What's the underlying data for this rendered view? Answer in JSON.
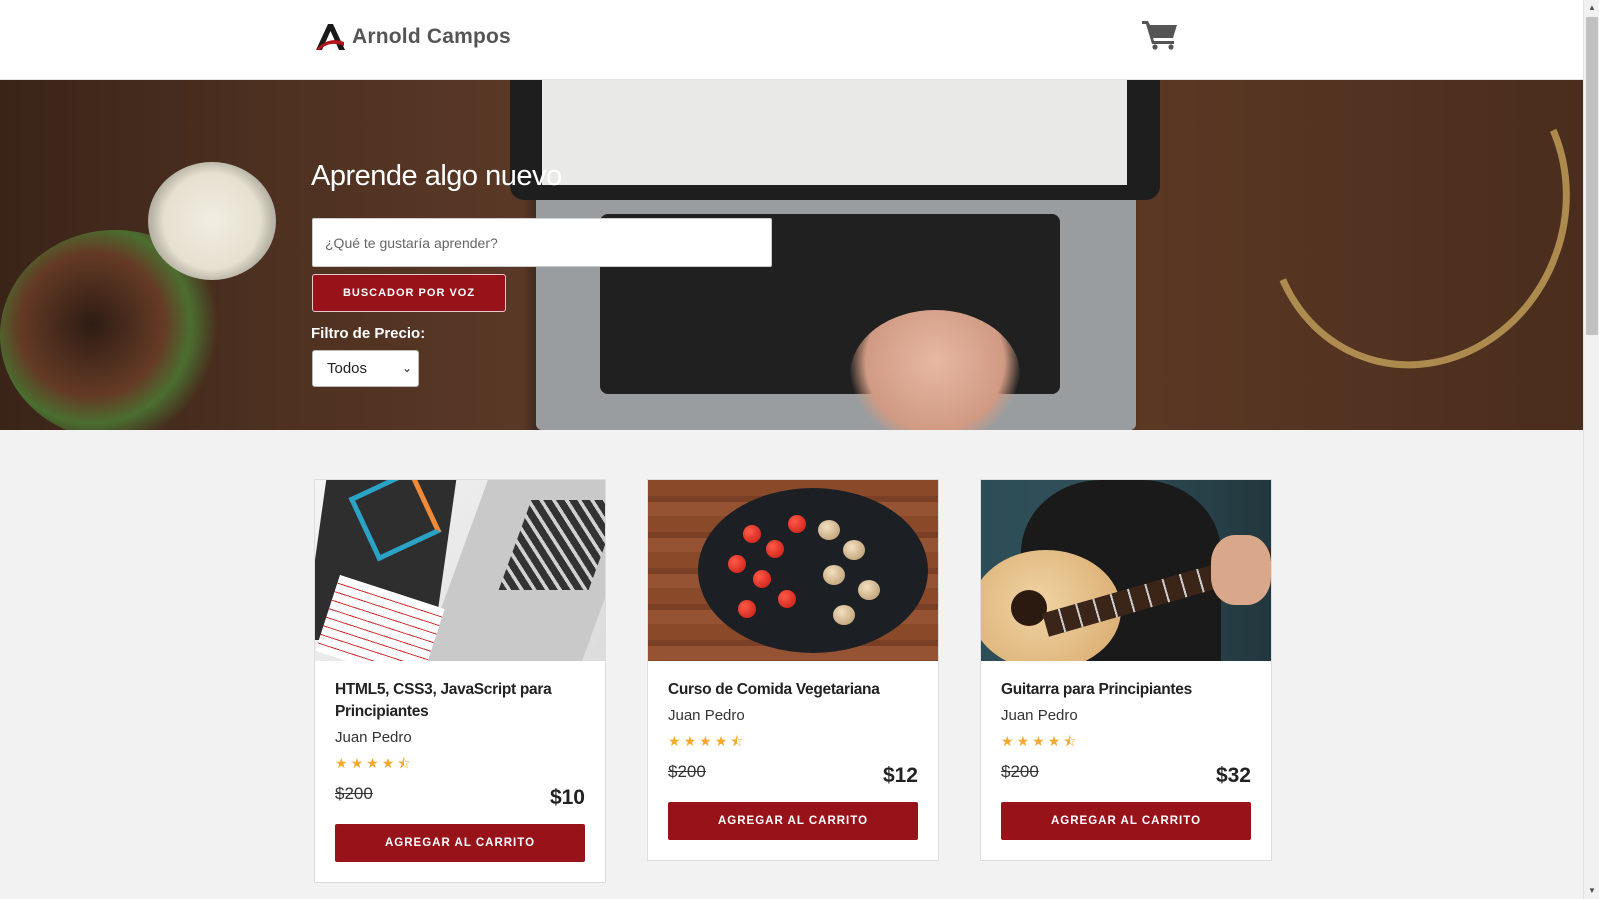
{
  "header": {
    "brand": "Arnold Campos",
    "cart_icon": "shopping-cart-icon"
  },
  "hero": {
    "title": "Aprende algo nuevo",
    "search_placeholder": "¿Qué te gustaría aprender?",
    "voice_button": "BUSCADOR POR VOZ",
    "filter_label": "Filtro de Precio:",
    "filter_selected": "Todos"
  },
  "courses": [
    {
      "title": "HTML5, CSS3, JavaScript para Principiantes",
      "author": "Juan Pedro",
      "rating": 4.5,
      "old_price": "$200",
      "price": "$10",
      "button": "AGREGAR AL CARRITO"
    },
    {
      "title": "Curso de Comida Vegetariana",
      "author": "Juan Pedro",
      "rating": 4.5,
      "old_price": "$200",
      "price": "$12",
      "button": "AGREGAR AL CARRITO"
    },
    {
      "title": "Guitarra para Principiantes",
      "author": "Juan Pedro",
      "rating": 4.5,
      "old_price": "$200",
      "price": "$32",
      "button": "AGREGAR AL CARRITO"
    }
  ],
  "colors": {
    "accent": "#98121a",
    "star": "#f3a92d"
  }
}
